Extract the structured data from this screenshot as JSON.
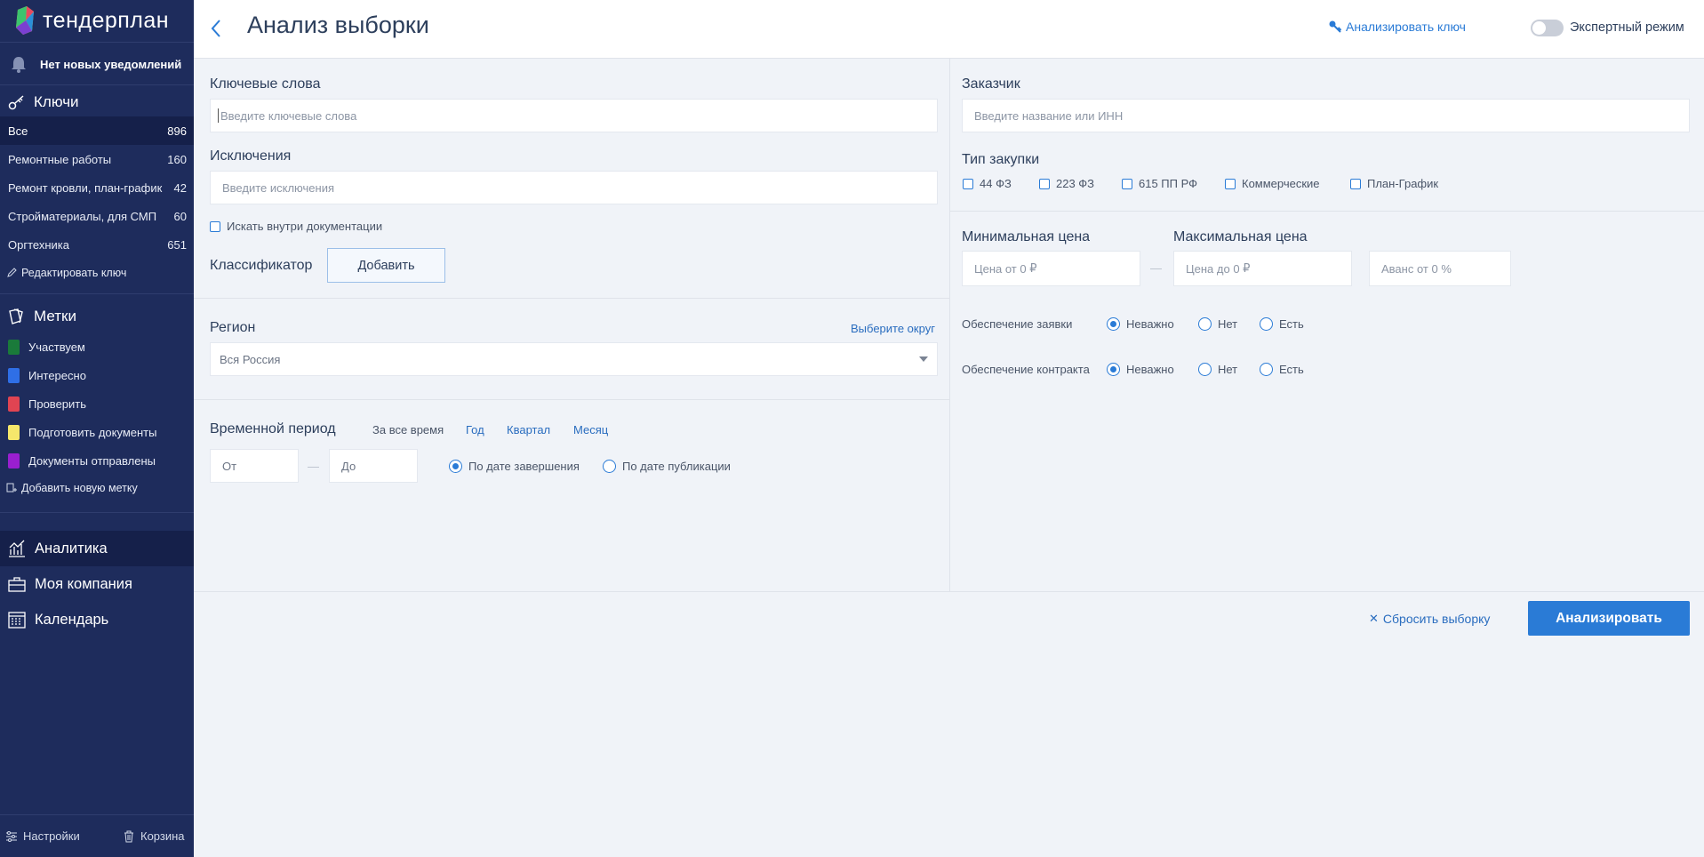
{
  "brand": {
    "name": "тендерплан"
  },
  "notifications": {
    "text": "Нет новых уведомлений"
  },
  "keys": {
    "title": "Ключи",
    "items": [
      {
        "label": "Все",
        "count": "896"
      },
      {
        "label": "Ремонтные работы",
        "count": "160"
      },
      {
        "label": "Ремонт кровли, план-график",
        "count": "42"
      },
      {
        "label": "Стройматериалы, для СМП",
        "count": "60"
      },
      {
        "label": "Оргтехника",
        "count": "651"
      }
    ],
    "edit_label": "Редактировать ключ"
  },
  "tags": {
    "title": "Метки",
    "items": [
      {
        "label": "Участвуем",
        "color": "#1a7a3a"
      },
      {
        "label": "Интересно",
        "color": "#2f6fe6"
      },
      {
        "label": "Проверить",
        "color": "#e04452"
      },
      {
        "label": "Подготовить документы",
        "color": "#f5e76b"
      },
      {
        "label": "Документы отправлены",
        "color": "#9a1fd0"
      }
    ],
    "add_label": "Добавить новую метку"
  },
  "nav": {
    "analytics": "Аналитика",
    "company": "Моя компания",
    "calendar": "Календарь"
  },
  "footer": {
    "settings": "Настройки",
    "trash": "Корзина"
  },
  "header": {
    "title": "Анализ выборки",
    "analyze_key": "Анализировать ключ",
    "expert_mode": "Экспертный режим",
    "expert_enabled": false
  },
  "form": {
    "keywords": {
      "label": "Ключевые слова",
      "placeholder": "Введите ключевые слова"
    },
    "exclusions": {
      "label": "Исключения",
      "placeholder": "Введите исключения"
    },
    "search_docs": "Искать внутри документации",
    "classifier": {
      "label": "Классификатор",
      "button": "Добавить"
    },
    "region": {
      "label": "Регион",
      "link": "Выберите округ",
      "value": "Вся Россия"
    },
    "period": {
      "label": "Временной период",
      "options": [
        "За все время",
        "Год",
        "Квартал",
        "Месяц"
      ],
      "from": "От",
      "to": "До",
      "by_end": "По дате завершения",
      "by_publication": "По дате публикации",
      "selected": "by_end"
    },
    "customer": {
      "label": "Заказчик",
      "placeholder": "Введите название или ИНН"
    },
    "purchase_type": {
      "label": "Тип закупки",
      "options": [
        "44 ФЗ",
        "223 ФЗ",
        "615 ПП РФ",
        "Коммерческие",
        "План-График"
      ]
    },
    "price": {
      "min_label": "Минимальная цена",
      "max_label": "Максимальная цена",
      "from_prefix": "Цена от",
      "from_value": "0",
      "to_prefix": "Цена до",
      "to_value": "0",
      "currency": "₽",
      "advance_prefix": "Аванс от",
      "advance_value": "0",
      "advance_unit": "%"
    },
    "bid_security": {
      "label": "Обеспечение заявки",
      "options": [
        "Неважно",
        "Нет",
        "Есть"
      ],
      "selected": "Неважно"
    },
    "contract_security": {
      "label": "Обеспечение контракта",
      "options": [
        "Неважно",
        "Нет",
        "Есть"
      ],
      "selected": "Неважно"
    }
  },
  "actions": {
    "reset": "Сбросить выборку",
    "analyze": "Анализировать"
  }
}
